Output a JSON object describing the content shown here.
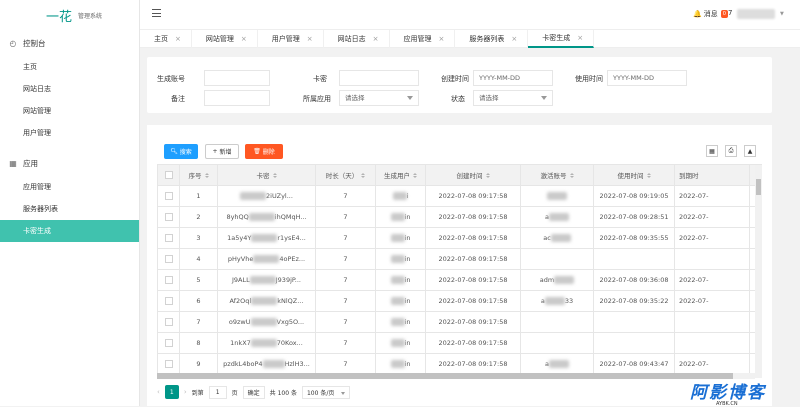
{
  "brand": {
    "name": "一花",
    "subtitle": "管理系统"
  },
  "sidebar": {
    "groups": [
      {
        "label": "控制台",
        "icon": "dashboard-icon",
        "items": [
          "主页",
          "网站日志",
          "网站管理",
          "用户管理"
        ]
      },
      {
        "label": "应用",
        "icon": "app-icon",
        "items": [
          "应用管理",
          "服务器列表",
          "卡密生成"
        ]
      }
    ],
    "active": "卡密生成"
  },
  "header": {
    "message_label": "消息",
    "message_badge": "0",
    "user_initial": "7"
  },
  "tabs": [
    {
      "label": "主页",
      "active": false
    },
    {
      "label": "网站管理",
      "active": false
    },
    {
      "label": "用户管理",
      "active": false
    },
    {
      "label": "网站日志",
      "active": false
    },
    {
      "label": "应用管理",
      "active": false
    },
    {
      "label": "服务器列表",
      "active": false
    },
    {
      "label": "卡密生成",
      "active": true
    }
  ],
  "search": {
    "gen_account_label": "生成账号",
    "card_label": "卡密",
    "create_time_label": "创建时间",
    "create_time_placeholder": "YYYY-MM-DD",
    "use_time_label": "使用时间",
    "use_time_placeholder": "YYYY-MM-DD",
    "remark_label": "备注",
    "app_label": "所属应用",
    "app_placeholder": "请选择",
    "status_label": "状态",
    "status_placeholder": "请选择"
  },
  "toolbar": {
    "search": "搜索",
    "add": "新增",
    "delete": "删除"
  },
  "table": {
    "columns": [
      "序号",
      "卡密",
      "时长（天）",
      "生成用户",
      "创建时间",
      "激活账号",
      "使用时间",
      "到期时"
    ],
    "rows": [
      {
        "no": "1",
        "card_head": "",
        "card_tail": "2iUZyl...",
        "days": "7",
        "user_tail": "i",
        "created": "2022-07-08 09:17:58",
        "act_head": "",
        "act_tail": "",
        "used": "2022-07-08 09:19:05",
        "expire": "2022-07-"
      },
      {
        "no": "2",
        "card_head": "8yhQQ",
        "card_tail": "ihQMqH...",
        "days": "7",
        "user_tail": "in",
        "created": "2022-07-08 09:17:58",
        "act_head": "a",
        "act_tail": "",
        "used": "2022-07-08 09:28:51",
        "expire": "2022-07-"
      },
      {
        "no": "3",
        "card_head": "1a5y4Y",
        "card_tail": "r1ysE4...",
        "days": "7",
        "user_tail": "in",
        "created": "2022-07-08 09:17:58",
        "act_head": "ac",
        "act_tail": "",
        "used": "2022-07-08 09:35:55",
        "expire": "2022-07-"
      },
      {
        "no": "4",
        "card_head": "pHyVhe",
        "card_tail": "4oPEz...",
        "days": "7",
        "user_tail": "in",
        "created": "2022-07-08 09:17:58",
        "act_head": "",
        "act_tail": "",
        "used": "",
        "expire": ""
      },
      {
        "no": "5",
        "card_head": "J9ALL",
        "card_tail": "J939jP...",
        "days": "7",
        "user_tail": "in",
        "created": "2022-07-08 09:17:58",
        "act_head": "adm",
        "act_tail": "",
        "used": "2022-07-08 09:36:08",
        "expire": "2022-07-"
      },
      {
        "no": "6",
        "card_head": "Af2Oql",
        "card_tail": "kNlQZ...",
        "days": "7",
        "user_tail": "in",
        "created": "2022-07-08 09:17:58",
        "act_head": "a",
        "act_tail": "33",
        "used": "2022-07-08 09:35:22",
        "expire": "2022-07-"
      },
      {
        "no": "7",
        "card_head": "o9zwU",
        "card_tail": "Vxg5O...",
        "days": "7",
        "user_tail": "in",
        "created": "2022-07-08 09:17:58",
        "act_head": "",
        "act_tail": "",
        "used": "",
        "expire": ""
      },
      {
        "no": "8",
        "card_head": "1nkX7",
        "card_tail": "70Kox...",
        "days": "7",
        "user_tail": "in",
        "created": "2022-07-08 09:17:58",
        "act_head": "",
        "act_tail": "",
        "used": "",
        "expire": ""
      },
      {
        "no": "9",
        "card_head": "pzdkL4boP4",
        "card_tail": "HzlH3...",
        "days": "7",
        "user_tail": "in",
        "created": "2022-07-08 09:17:58",
        "act_head": "a",
        "act_tail": "",
        "used": "2022-07-08 09:43:47",
        "expire": "2022-07-"
      }
    ]
  },
  "pager": {
    "current": "1",
    "goto_label": "到第",
    "page_value": "1",
    "page_unit": "页",
    "confirm": "确定",
    "total": "共 100 条",
    "page_size": "100 条/页"
  },
  "watermark": {
    "main": "阿影博客",
    "sub": "AYBK.CN"
  }
}
